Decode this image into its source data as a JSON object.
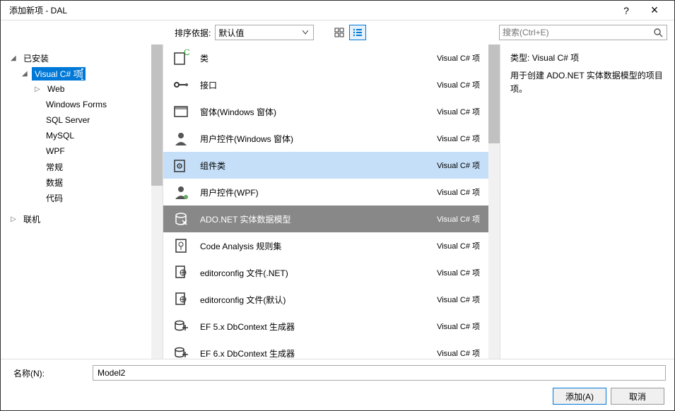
{
  "window": {
    "title": "添加新项 - DAL",
    "help": "?",
    "close": "×"
  },
  "sort": {
    "label": "排序依据:",
    "value": "默认值"
  },
  "search": {
    "placeholder": "搜索(Ctrl+E)"
  },
  "tree": {
    "installed": {
      "label": "已安装"
    },
    "visual_csharp": {
      "label": "Visual C# 项"
    },
    "web": "Web",
    "winforms": "Windows Forms",
    "sqlserver": "SQL Server",
    "mysql": "MySQL",
    "wpf": "WPF",
    "general": "常规",
    "data": "数据",
    "code": "代码",
    "online": "联机"
  },
  "items": [
    {
      "name": "类",
      "type": "Visual C# 项",
      "icon": "class"
    },
    {
      "name": "接口",
      "type": "Visual C# 项",
      "icon": "interface"
    },
    {
      "name": "窗体(Windows 窗体)",
      "type": "Visual C# 项",
      "icon": "form"
    },
    {
      "name": "用户控件(Windows 窗体)",
      "type": "Visual C# 项",
      "icon": "usercontrol"
    },
    {
      "name": "组件类",
      "type": "Visual C# 项",
      "icon": "component"
    },
    {
      "name": "用户控件(WPF)",
      "type": "Visual C# 项",
      "icon": "usercontrolwpf"
    },
    {
      "name": "ADO.NET 实体数据模型",
      "type": "Visual C# 项",
      "icon": "adonet"
    },
    {
      "name": "Code Analysis 规则集",
      "type": "Visual C# 项",
      "icon": "ruleset"
    },
    {
      "name": "editorconfig 文件(.NET)",
      "type": "Visual C# 项",
      "icon": "editorconfig"
    },
    {
      "name": "editorconfig 文件(默认)",
      "type": "Visual C# 项",
      "icon": "editorconfig"
    },
    {
      "name": "EF 5.x DbContext 生成器",
      "type": "Visual C# 项",
      "icon": "ef"
    },
    {
      "name": "EF 6.x DbContext 生成器",
      "type": "Visual C# 项",
      "icon": "ef"
    }
  ],
  "selectedIndex": 6,
  "hoveredIndex": 4,
  "detail": {
    "typeLabel": "类型:",
    "typeValue": "Visual C# 项",
    "desc": "用于创建 ADO.NET 实体数据模型的项目项。"
  },
  "name": {
    "label": "名称(N):",
    "value": "Model2"
  },
  "buttons": {
    "add": "添加(A)",
    "cancel": "取消"
  }
}
